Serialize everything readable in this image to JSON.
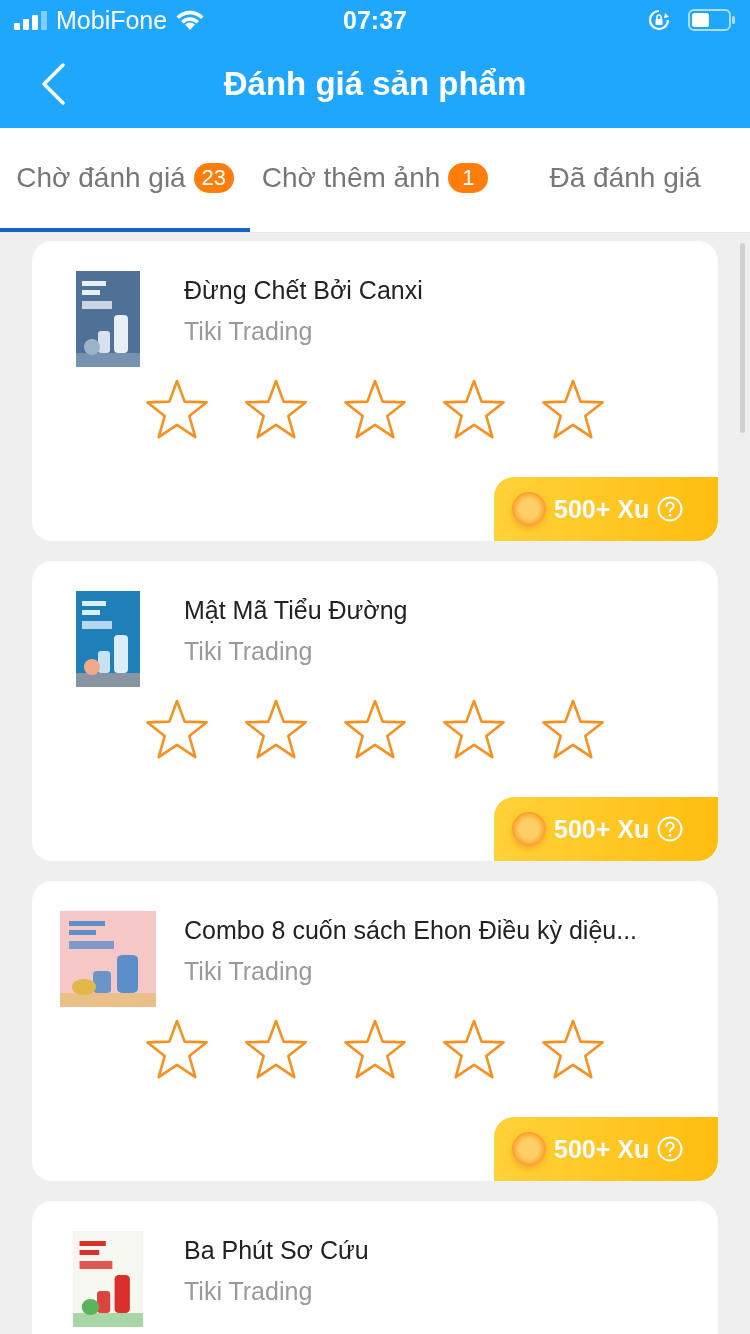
{
  "status_bar": {
    "carrier": "MobiFone",
    "time": "07:37"
  },
  "header": {
    "title": "Đánh giá sản phẩm"
  },
  "tabs": [
    {
      "label": "Chờ đánh giá",
      "count": "23",
      "selected": true
    },
    {
      "label": "Chờ thêm ảnh",
      "count": "1",
      "selected": false
    },
    {
      "label": "Đã đánh giá",
      "selected": false
    }
  ],
  "products": [
    {
      "title": "Đừng Chết Bởi Canxi",
      "seller": "Tiki Trading",
      "stars": 0,
      "reward": "500+ Xu"
    },
    {
      "title": "Mật Mã Tiểu Đường",
      "seller": "Tiki Trading",
      "stars": 0,
      "reward": "500+ Xu"
    },
    {
      "title": "Combo 8 cuốn sách Ehon Điều kỳ diệu...",
      "seller": "Tiki Trading",
      "stars": 0,
      "reward": "500+ Xu"
    },
    {
      "title": "Ba Phút Sơ Cứu",
      "seller": "Tiki Trading"
    }
  ]
}
